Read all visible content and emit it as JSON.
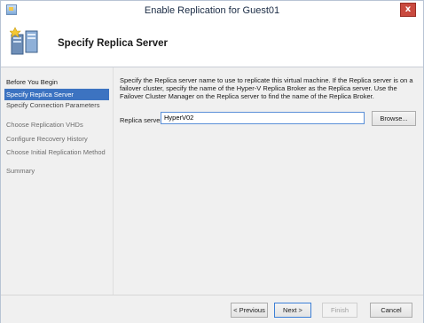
{
  "window": {
    "title": "Enable Replication for Guest01",
    "close_glyph": "x",
    "app_icon": "hyper-v-icon"
  },
  "header": {
    "title": "Specify Replica Server",
    "icon": "replica-server-icon"
  },
  "sidebar": {
    "steps": [
      {
        "label": "Before You Begin",
        "state": "done"
      },
      {
        "label": "Specify Replica Server",
        "state": "active"
      },
      {
        "label": "Specify Connection Parameters",
        "state": "pending"
      },
      {
        "label": "Choose Replication VHDs",
        "state": "pending"
      },
      {
        "label": "Configure Recovery History",
        "state": "pending"
      },
      {
        "label": "Choose Initial Replication Method",
        "state": "pending"
      },
      {
        "label": "Summary",
        "state": "pending"
      }
    ]
  },
  "content": {
    "description": "Specify the Replica server name to use to replicate this virtual machine. If the Replica server is on a failover cluster, specify the name of the Hyper-V Replica Broker as the Replica server. Use the Failover Cluster Manager on the Replica server to find the name of the Replica Broker.",
    "replica_label": "Replica server:",
    "replica_value": "HyperV02",
    "browse_label": "Browse..."
  },
  "footer": {
    "previous_label": "< Previous",
    "next_label": "Next >",
    "finish_label": "Finish",
    "cancel_label": "Cancel"
  },
  "colors": {
    "accent": "#3c73c1",
    "close": "#c94a3f",
    "focus_border": "#5a8fd8"
  }
}
